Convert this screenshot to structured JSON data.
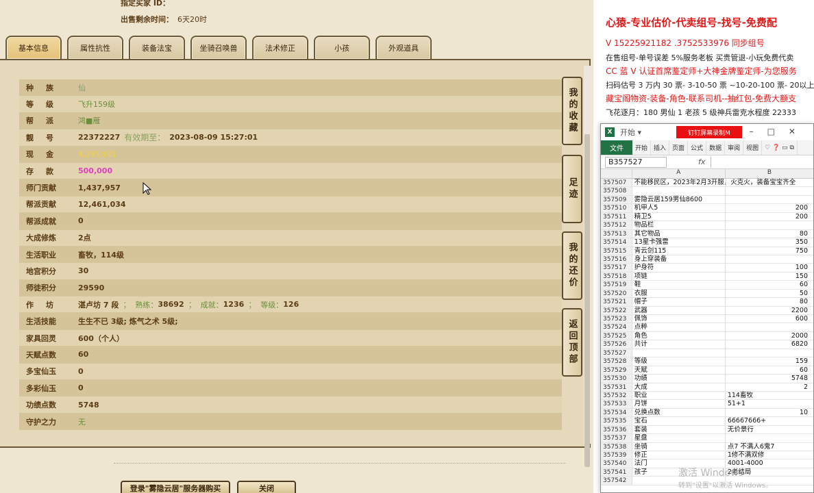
{
  "top": {
    "seller_label": "指定买家 ID：",
    "time_label": "出售剩余时间：",
    "time_value": "6天20时"
  },
  "tabs": [
    "基本信息",
    "属性抗性",
    "装备法宝",
    "坐骑召唤兽",
    "法术修正",
    "小孩",
    "外观道具"
  ],
  "rows": [
    {
      "label": "种族",
      "value": "仙"
    },
    {
      "label": "等级",
      "value": "飞升159级"
    },
    {
      "label": "帮派",
      "value": "鸿■雁"
    },
    {
      "label": "靓号",
      "value": "22372227",
      "extra_label": "有效期至：",
      "extra_value": "2023-08-09 15:27:01"
    },
    {
      "label": "现金",
      "value": "4,295,831"
    },
    {
      "label": "存款",
      "value": "500,000"
    },
    {
      "label": "师门贡献",
      "value": "1,437,957"
    },
    {
      "label": "帮派贡献",
      "value": "12,461,034"
    },
    {
      "label": "帮派成就",
      "value": "0"
    },
    {
      "label": "大成修炼",
      "value": "2点"
    },
    {
      "label": "生活职业",
      "value": "畜牧，114级"
    },
    {
      "label": "地宫积分",
      "value": "30"
    },
    {
      "label": "师徒积分",
      "value": "29590"
    },
    {
      "label": "作坊",
      "value": "湛卢坊 7 段",
      "p1": "熟练：",
      "v1": "38692",
      "p2": "成就：",
      "v2": "1236",
      "p3": "等级：",
      "v3": "126"
    },
    {
      "label": "生活技能",
      "value": "生生不已 3级; 炼气之术 5级;"
    },
    {
      "label": "家具回灵",
      "value": "600（个人）"
    },
    {
      "label": "天赋点数",
      "value": "60"
    },
    {
      "label": "多宝仙玉",
      "value": "0"
    },
    {
      "label": "多彩仙玉",
      "value": "0"
    },
    {
      "label": "功绩点数",
      "value": "5748"
    },
    {
      "label": "守护之力",
      "value": "无"
    }
  ],
  "side_buttons": [
    "我的收藏",
    "足迹",
    "我的还价",
    "返回顶部"
  ],
  "bottom_buttons": {
    "login": "登录\"雾隐云居\"服务器购买",
    "close": "关闭"
  },
  "ad": {
    "line1": "心猿-专业估价-代卖组号-找号-免费配",
    "line2": "V 15225921182   .3752533976 同步组号",
    "line3": "在售组号-单号误差 5%服务老板 买贵管退-小玩免费代卖",
    "line4": "CC 蓝 V 认证首席鉴定师+大神金牌鉴定师-为您服务",
    "line5": "扫码估号 3 万内 30 票- 3-10-50 票  ~10-20-100 票- 20以上 参",
    "line6": "藏宝阁物资-装备-角色-联系司机--抽红包-免费大额支",
    "line7": "飞花逐月：180 男仙 1 老孩 5 级神兵雷克水程度 22333"
  },
  "excel": {
    "qa": "开始 ▾  ",
    "recording": "钉钉屏幕录制M",
    "ribbon": [
      "文件",
      "开始",
      "插入",
      "页面",
      "公式",
      "数据",
      "审阅",
      "视图"
    ],
    "namebox": "B357527",
    "fx": "fx",
    "col_a": "A",
    "col_b": "B",
    "rows": [
      {
        "n": "357507",
        "a": "不能移民区，2023年2月3开服，火克火，装备宝宝齐全",
        "b": ""
      },
      {
        "n": "357508",
        "a": "",
        "b": ""
      },
      {
        "n": "357509",
        "a": "雾隐云居159男仙8600",
        "b": ""
      },
      {
        "n": "357510",
        "a": "机甲人5",
        "b": "200"
      },
      {
        "n": "357511",
        "a": "精卫5",
        "b": "200"
      },
      {
        "n": "357512",
        "a": "物品栏",
        "b": ""
      },
      {
        "n": "357513",
        "a": "其它物品",
        "b": "80"
      },
      {
        "n": "357514",
        "a": "13星卡强雷",
        "b": "350"
      },
      {
        "n": "357515",
        "a": "青云剑115",
        "b": "750"
      },
      {
        "n": "357516",
        "a": "身上穿装备",
        "b": ""
      },
      {
        "n": "357517",
        "a": "护身符",
        "b": "100"
      },
      {
        "n": "357518",
        "a": "项链",
        "b": "150"
      },
      {
        "n": "357519",
        "a": "鞋",
        "b": "60"
      },
      {
        "n": "357520",
        "a": "衣服",
        "b": "50"
      },
      {
        "n": "357521",
        "a": "帽子",
        "b": "80"
      },
      {
        "n": "357522",
        "a": "武器",
        "b": "2200"
      },
      {
        "n": "357523",
        "a": "佩饰",
        "b": "600"
      },
      {
        "n": "357524",
        "a": "点粹",
        "b": ""
      },
      {
        "n": "357525",
        "a": "角色",
        "b": "2000"
      },
      {
        "n": "357526",
        "a": "共计",
        "b": "6820"
      },
      {
        "n": "357527",
        "a": "",
        "b": ""
      },
      {
        "n": "357528",
        "a": "等级",
        "b": "159"
      },
      {
        "n": "357529",
        "a": "天赋",
        "b": "60"
      },
      {
        "n": "357530",
        "a": "功绩",
        "b": "5748"
      },
      {
        "n": "357531",
        "a": "大成",
        "b": "2"
      },
      {
        "n": "357532",
        "a": "职业",
        "b": "114畜牧"
      },
      {
        "n": "357533",
        "a": "月饼",
        "b": "51+1"
      },
      {
        "n": "357534",
        "a": "兑换点数",
        "b": "10"
      },
      {
        "n": "357535",
        "a": "宝石",
        "b": "66667666+"
      },
      {
        "n": "357536",
        "a": "套装",
        "b": "无价景行"
      },
      {
        "n": "357537",
        "a": "星盘",
        "b": ""
      },
      {
        "n": "357538",
        "a": "坐骑",
        "b": "点7 不满人6鬼7"
      },
      {
        "n": "357539",
        "a": "修正",
        "b": "1修不满双修"
      },
      {
        "n": "357540",
        "a": "法门",
        "b": "4001-4000"
      },
      {
        "n": "357541",
        "a": "孩子",
        "b": "2老结局"
      },
      {
        "n": "357542",
        "a": "",
        "b": ""
      }
    ],
    "watermark": "激活 Windows",
    "watermark2": "转到\"设置\"以激活 Windows。"
  }
}
